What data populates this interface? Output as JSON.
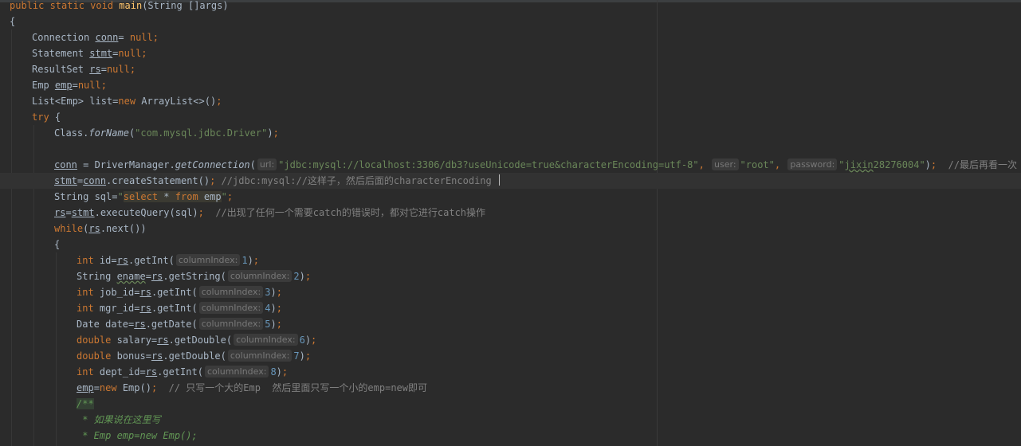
{
  "editor": {
    "language": "java",
    "lines": [
      {
        "indent": 0,
        "tokens": [
          {
            "t": "public static void ",
            "c": "kw"
          },
          {
            "t": "main",
            "c": "fn"
          },
          {
            "t": "(String []args)"
          }
        ]
      },
      {
        "indent": 0,
        "tokens": [
          {
            "t": "{"
          }
        ]
      },
      {
        "indent": 1,
        "tokens": [
          {
            "t": "Connection "
          },
          {
            "t": "conn",
            "c": "u"
          },
          {
            "t": "= "
          },
          {
            "t": "null",
            "c": "kw"
          },
          {
            "t": ";",
            "c": "kw"
          }
        ]
      },
      {
        "indent": 1,
        "tokens": [
          {
            "t": "Statement "
          },
          {
            "t": "stmt",
            "c": "u"
          },
          {
            "t": "="
          },
          {
            "t": "null",
            "c": "kw"
          },
          {
            "t": ";",
            "c": "kw"
          }
        ]
      },
      {
        "indent": 1,
        "tokens": [
          {
            "t": "ResultSet "
          },
          {
            "t": "rs",
            "c": "u"
          },
          {
            "t": "="
          },
          {
            "t": "null",
            "c": "kw"
          },
          {
            "t": ";",
            "c": "kw"
          }
        ]
      },
      {
        "indent": 1,
        "tokens": [
          {
            "t": "Emp "
          },
          {
            "t": "emp",
            "c": "u"
          },
          {
            "t": "="
          },
          {
            "t": "null",
            "c": "kw"
          },
          {
            "t": ";",
            "c": "kw"
          }
        ]
      },
      {
        "indent": 1,
        "tokens": [
          {
            "t": "List<Emp> list="
          },
          {
            "t": "new ",
            "c": "kw"
          },
          {
            "t": "ArrayList<>()"
          },
          {
            "t": ";",
            "c": "kw"
          }
        ]
      },
      {
        "indent": 1,
        "tokens": [
          {
            "t": "try ",
            "c": "kw"
          },
          {
            "t": "{"
          }
        ]
      },
      {
        "indent": 2,
        "tokens": [
          {
            "t": "Class."
          },
          {
            "t": "forName",
            "c": "it"
          },
          {
            "t": "("
          },
          {
            "t": "\"com.mysql.jdbc.Driver\"",
            "c": "str"
          },
          {
            "t": ")"
          },
          {
            "t": ";",
            "c": "kw"
          }
        ]
      },
      {
        "indent": 0,
        "tokens": []
      },
      {
        "indent": 2,
        "tokens": [
          {
            "t": "conn",
            "c": "u"
          },
          {
            "t": " = DriverManager."
          },
          {
            "t": "getConnection",
            "c": "it"
          },
          {
            "t": "("
          },
          {
            "hint": "url:"
          },
          {
            "t": "\"jdbc:mysql://localhost:3306/db3?useUnicode=true&characterEncoding=utf-8\"",
            "c": "str"
          },
          {
            "t": ", ",
            "c": "kw"
          },
          {
            "hint": "user:"
          },
          {
            "t": "\"root\"",
            "c": "str"
          },
          {
            "t": ", ",
            "c": "kw"
          },
          {
            "hint": "password:"
          },
          {
            "t": "\"",
            "c": "str"
          },
          {
            "t": "jixin",
            "c": "str wavy"
          },
          {
            "t": "28276004\"",
            "c": "str"
          },
          {
            "t": ")"
          },
          {
            "t": ";",
            "c": "kw"
          },
          {
            "t": "  //最后再看一次",
            "c": "cmt"
          }
        ]
      },
      {
        "indent": 2,
        "current": true,
        "tokens": [
          {
            "t": "stmt",
            "c": "u"
          },
          {
            "t": "="
          },
          {
            "t": "conn",
            "c": "u"
          },
          {
            "t": ".createStatement()"
          },
          {
            "t": ";",
            "c": "kw"
          },
          {
            "t": " //jdbc:mysql://这样子，然后后面的characterEncoding ",
            "c": "cmt"
          },
          {
            "caret": true
          }
        ]
      },
      {
        "indent": 2,
        "tokens": [
          {
            "t": "String sql="
          },
          {
            "t": "\"",
            "c": "str"
          },
          {
            "t": "select",
            "c": "kw hl"
          },
          {
            "t": " * ",
            "c": "hl"
          },
          {
            "t": "from",
            "c": "kw hl"
          },
          {
            "t": " emp",
            "c": "hl"
          },
          {
            "t": "\"",
            "c": "str"
          },
          {
            "t": ";",
            "c": "kw"
          }
        ]
      },
      {
        "indent": 2,
        "tokens": [
          {
            "t": "rs",
            "c": "u"
          },
          {
            "t": "="
          },
          {
            "t": "stmt",
            "c": "u"
          },
          {
            "t": ".executeQuery(sql)"
          },
          {
            "t": ";",
            "c": "kw"
          },
          {
            "t": "  //出现了任何一个需要catch的错误时，都对它进行catch操作",
            "c": "cmt"
          }
        ]
      },
      {
        "indent": 2,
        "tokens": [
          {
            "t": "while",
            "c": "kw"
          },
          {
            "t": "("
          },
          {
            "t": "rs",
            "c": "u"
          },
          {
            "t": ".next())"
          }
        ]
      },
      {
        "indent": 2,
        "tokens": [
          {
            "t": "{"
          }
        ]
      },
      {
        "indent": 3,
        "tokens": [
          {
            "t": "int ",
            "c": "kw"
          },
          {
            "t": "id="
          },
          {
            "t": "rs",
            "c": "u"
          },
          {
            "t": ".getInt("
          },
          {
            "hint": "columnIndex:"
          },
          {
            "t": "1",
            "c": "num"
          },
          {
            "t": ")"
          },
          {
            "t": ";",
            "c": "kw"
          }
        ]
      },
      {
        "indent": 3,
        "tokens": [
          {
            "t": "String "
          },
          {
            "t": "ename",
            "c": "wavy"
          },
          {
            "t": "="
          },
          {
            "t": "rs",
            "c": "u"
          },
          {
            "t": ".getString("
          },
          {
            "hint": "columnIndex:"
          },
          {
            "t": "2",
            "c": "num"
          },
          {
            "t": ")"
          },
          {
            "t": ";",
            "c": "kw"
          }
        ]
      },
      {
        "indent": 3,
        "tokens": [
          {
            "t": "int ",
            "c": "kw"
          },
          {
            "t": "job_id="
          },
          {
            "t": "rs",
            "c": "u"
          },
          {
            "t": ".getInt("
          },
          {
            "hint": "columnIndex:"
          },
          {
            "t": "3",
            "c": "num"
          },
          {
            "t": ")"
          },
          {
            "t": ";",
            "c": "kw"
          }
        ]
      },
      {
        "indent": 3,
        "tokens": [
          {
            "t": "int ",
            "c": "kw"
          },
          {
            "t": "mgr_id="
          },
          {
            "t": "rs",
            "c": "u"
          },
          {
            "t": ".getInt("
          },
          {
            "hint": "columnIndex:"
          },
          {
            "t": "4",
            "c": "num"
          },
          {
            "t": ")"
          },
          {
            "t": ";",
            "c": "kw"
          }
        ]
      },
      {
        "indent": 3,
        "tokens": [
          {
            "t": "Date date="
          },
          {
            "t": "rs",
            "c": "u"
          },
          {
            "t": ".getDate("
          },
          {
            "hint": "columnIndex:"
          },
          {
            "t": "5",
            "c": "num"
          },
          {
            "t": ")"
          },
          {
            "t": ";",
            "c": "kw"
          }
        ]
      },
      {
        "indent": 3,
        "tokens": [
          {
            "t": "double ",
            "c": "kw"
          },
          {
            "t": "salary="
          },
          {
            "t": "rs",
            "c": "u"
          },
          {
            "t": ".getDouble("
          },
          {
            "hint": "columnIndex:"
          },
          {
            "t": "6",
            "c": "num"
          },
          {
            "t": ")"
          },
          {
            "t": ";",
            "c": "kw"
          }
        ]
      },
      {
        "indent": 3,
        "tokens": [
          {
            "t": "double ",
            "c": "kw"
          },
          {
            "t": "bonus="
          },
          {
            "t": "rs",
            "c": "u"
          },
          {
            "t": ".getDouble("
          },
          {
            "hint": "columnIndex:"
          },
          {
            "t": "7",
            "c": "num"
          },
          {
            "t": ")"
          },
          {
            "t": ";",
            "c": "kw"
          }
        ]
      },
      {
        "indent": 3,
        "tokens": [
          {
            "t": "int ",
            "c": "kw"
          },
          {
            "t": "dept_id="
          },
          {
            "t": "rs",
            "c": "u"
          },
          {
            "t": ".getInt("
          },
          {
            "hint": "columnIndex:"
          },
          {
            "t": "8",
            "c": "num"
          },
          {
            "t": ")"
          },
          {
            "t": ";",
            "c": "kw"
          }
        ]
      },
      {
        "indent": 3,
        "tokens": [
          {
            "t": "emp",
            "c": "u"
          },
          {
            "t": "="
          },
          {
            "t": "new ",
            "c": "kw"
          },
          {
            "t": "Emp()"
          },
          {
            "t": ";",
            "c": "kw"
          },
          {
            "t": "  // 只写一个大的Emp  然后里面只写一个小的emp=new即可",
            "c": "cmt"
          }
        ]
      },
      {
        "indent": 3,
        "tokens": [
          {
            "t": "/**",
            "c": "doc doc-hl"
          }
        ]
      },
      {
        "indent": 3,
        "tokens": [
          {
            "t": " * 如果说在这里写",
            "c": "doc"
          }
        ]
      },
      {
        "indent": 3,
        "tokens": [
          {
            "t": " * Emp emp=new Emp();",
            "c": "doc"
          }
        ]
      }
    ]
  }
}
